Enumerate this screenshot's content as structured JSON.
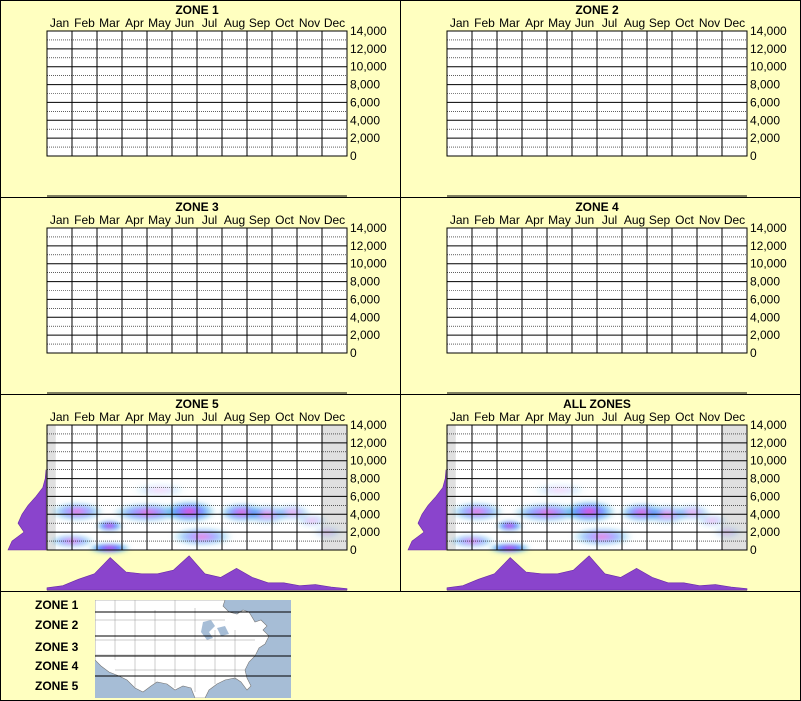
{
  "colors": {
    "background": "#ffffc0",
    "grid": "#000000",
    "profile_fill": "#8a44cc",
    "shade": "#e0e0e0",
    "map_water": "#a6bdd6",
    "map_land": "#ffffff"
  },
  "months": [
    "Jan",
    "Feb",
    "Mar",
    "Apr",
    "May",
    "Jun",
    "Jul",
    "Aug",
    "Sep",
    "Oct",
    "Nov",
    "Dec"
  ],
  "y_ticks": [
    "14,000",
    "12,000",
    "10,000",
    "8,000",
    "6,000",
    "4,000",
    "2,000",
    "0"
  ],
  "chart_data": [
    {
      "type": "heatmap",
      "title": "ZONE 1",
      "x_categories": [
        "Jan",
        "Feb",
        "Mar",
        "Apr",
        "May",
        "Jun",
        "Jul",
        "Aug",
        "Sep",
        "Oct",
        "Nov",
        "Dec"
      ],
      "ylim": [
        0,
        14000
      ],
      "grid": true,
      "blobs": [],
      "shaded_months": [],
      "monthly_profile": [],
      "elevation_profile": []
    },
    {
      "type": "heatmap",
      "title": "ZONE 2",
      "x_categories": [
        "Jan",
        "Feb",
        "Mar",
        "Apr",
        "May",
        "Jun",
        "Jul",
        "Aug",
        "Sep",
        "Oct",
        "Nov",
        "Dec"
      ],
      "ylim": [
        0,
        14000
      ],
      "grid": true,
      "blobs": [],
      "shaded_months": [],
      "monthly_profile": [],
      "elevation_profile": []
    },
    {
      "type": "heatmap",
      "title": "ZONE 3",
      "x_categories": [
        "Jan",
        "Feb",
        "Mar",
        "Apr",
        "May",
        "Jun",
        "Jul",
        "Aug",
        "Sep",
        "Oct",
        "Nov",
        "Dec"
      ],
      "ylim": [
        0,
        14000
      ],
      "grid": true,
      "blobs": [],
      "shaded_months": [],
      "monthly_profile": [],
      "elevation_profile": []
    },
    {
      "type": "heatmap",
      "title": "ZONE 4",
      "x_categories": [
        "Jan",
        "Feb",
        "Mar",
        "Apr",
        "May",
        "Jun",
        "Jul",
        "Aug",
        "Sep",
        "Oct",
        "Nov",
        "Dec"
      ],
      "ylim": [
        0,
        14000
      ],
      "grid": true,
      "blobs": [],
      "shaded_months": [],
      "monthly_profile": [],
      "elevation_profile": []
    },
    {
      "type": "heatmap",
      "title": "ZONE 5",
      "x_categories": [
        "Jan",
        "Feb",
        "Mar",
        "Apr",
        "May",
        "Jun",
        "Jul",
        "Aug",
        "Sep",
        "Oct",
        "Nov",
        "Dec"
      ],
      "ylim": [
        0,
        14000
      ],
      "grid": true,
      "shaded_months": [
        0,
        11
      ],
      "blobs": [
        {
          "month": 2.5,
          "elev": 200,
          "intensity": 1.0,
          "sx": 0.55,
          "sy": 350
        },
        {
          "month": 2.5,
          "elev": 2700,
          "intensity": 0.85,
          "sx": 0.35,
          "sy": 400
        },
        {
          "month": 1.2,
          "elev": 4300,
          "intensity": 0.55,
          "sx": 0.7,
          "sy": 700
        },
        {
          "month": 1.0,
          "elev": 1000,
          "intensity": 0.5,
          "sx": 0.6,
          "sy": 500
        },
        {
          "month": 4.0,
          "elev": 4200,
          "intensity": 0.6,
          "sx": 0.9,
          "sy": 700
        },
        {
          "month": 5.7,
          "elev": 4300,
          "intensity": 0.75,
          "sx": 0.7,
          "sy": 800
        },
        {
          "month": 6.2,
          "elev": 1500,
          "intensity": 0.5,
          "sx": 0.8,
          "sy": 700
        },
        {
          "month": 7.8,
          "elev": 4200,
          "intensity": 0.65,
          "sx": 0.6,
          "sy": 700
        },
        {
          "month": 8.8,
          "elev": 4000,
          "intensity": 0.45,
          "sx": 0.6,
          "sy": 700
        },
        {
          "month": 9.8,
          "elev": 4200,
          "intensity": 0.35,
          "sx": 0.5,
          "sy": 600
        },
        {
          "month": 10.6,
          "elev": 3300,
          "intensity": 0.25,
          "sx": 0.4,
          "sy": 500
        },
        {
          "month": 11.2,
          "elev": 2000,
          "intensity": 0.2,
          "sx": 0.4,
          "sy": 500
        },
        {
          "month": 4.5,
          "elev": 6700,
          "intensity": 0.15,
          "sx": 0.7,
          "sy": 500
        }
      ],
      "monthly_profile": [
        0.06,
        0.12,
        0.3,
        0.45,
        0.9,
        0.5,
        0.45,
        0.45,
        0.55,
        0.95,
        0.45,
        0.35,
        0.6,
        0.35,
        0.2,
        0.2,
        0.12,
        0.15,
        0.08,
        0.04
      ],
      "elevation_profile": [
        {
          "elev": 0,
          "v": 0.95
        },
        {
          "elev": 1000,
          "v": 0.85
        },
        {
          "elev": 2000,
          "v": 0.55
        },
        {
          "elev": 3000,
          "v": 0.7
        },
        {
          "elev": 4000,
          "v": 0.6
        },
        {
          "elev": 5000,
          "v": 0.45
        },
        {
          "elev": 6000,
          "v": 0.25
        },
        {
          "elev": 7000,
          "v": 0.08
        },
        {
          "elev": 8000,
          "v": 0.02
        },
        {
          "elev": 9000,
          "v": 0
        }
      ]
    },
    {
      "type": "heatmap",
      "title": "ALL ZONES",
      "x_categories": [
        "Jan",
        "Feb",
        "Mar",
        "Apr",
        "May",
        "Jun",
        "Jul",
        "Aug",
        "Sep",
        "Oct",
        "Nov",
        "Dec"
      ],
      "ylim": [
        0,
        14000
      ],
      "grid": true,
      "shaded_months": [
        0,
        11
      ],
      "blobs": [
        {
          "month": 2.5,
          "elev": 200,
          "intensity": 1.0,
          "sx": 0.55,
          "sy": 350
        },
        {
          "month": 2.5,
          "elev": 2700,
          "intensity": 0.85,
          "sx": 0.35,
          "sy": 400
        },
        {
          "month": 1.2,
          "elev": 4300,
          "intensity": 0.55,
          "sx": 0.7,
          "sy": 700
        },
        {
          "month": 1.0,
          "elev": 1000,
          "intensity": 0.5,
          "sx": 0.6,
          "sy": 500
        },
        {
          "month": 4.0,
          "elev": 4200,
          "intensity": 0.6,
          "sx": 0.9,
          "sy": 700
        },
        {
          "month": 5.7,
          "elev": 4300,
          "intensity": 0.75,
          "sx": 0.7,
          "sy": 800
        },
        {
          "month": 6.2,
          "elev": 1500,
          "intensity": 0.5,
          "sx": 0.8,
          "sy": 700
        },
        {
          "month": 7.8,
          "elev": 4200,
          "intensity": 0.65,
          "sx": 0.6,
          "sy": 700
        },
        {
          "month": 8.8,
          "elev": 4000,
          "intensity": 0.45,
          "sx": 0.6,
          "sy": 700
        },
        {
          "month": 9.8,
          "elev": 4200,
          "intensity": 0.35,
          "sx": 0.5,
          "sy": 600
        },
        {
          "month": 10.6,
          "elev": 3300,
          "intensity": 0.25,
          "sx": 0.4,
          "sy": 500
        },
        {
          "month": 11.2,
          "elev": 2000,
          "intensity": 0.2,
          "sx": 0.4,
          "sy": 500
        },
        {
          "month": 4.5,
          "elev": 6700,
          "intensity": 0.15,
          "sx": 0.7,
          "sy": 500
        }
      ],
      "monthly_profile": [
        0.06,
        0.12,
        0.3,
        0.45,
        0.9,
        0.5,
        0.45,
        0.45,
        0.55,
        0.95,
        0.45,
        0.35,
        0.6,
        0.35,
        0.2,
        0.2,
        0.12,
        0.15,
        0.08,
        0.04
      ],
      "elevation_profile": [
        {
          "elev": 0,
          "v": 0.95
        },
        {
          "elev": 1000,
          "v": 0.85
        },
        {
          "elev": 2000,
          "v": 0.55
        },
        {
          "elev": 3000,
          "v": 0.7
        },
        {
          "elev": 4000,
          "v": 0.6
        },
        {
          "elev": 5000,
          "v": 0.45
        },
        {
          "elev": 6000,
          "v": 0.25
        },
        {
          "elev": 7000,
          "v": 0.08
        },
        {
          "elev": 8000,
          "v": 0.02
        },
        {
          "elev": 9000,
          "v": 0
        }
      ]
    }
  ],
  "legend": {
    "zones": [
      "ZONE 1",
      "ZONE 2",
      "ZONE 3",
      "ZONE 4",
      "ZONE 5"
    ]
  }
}
